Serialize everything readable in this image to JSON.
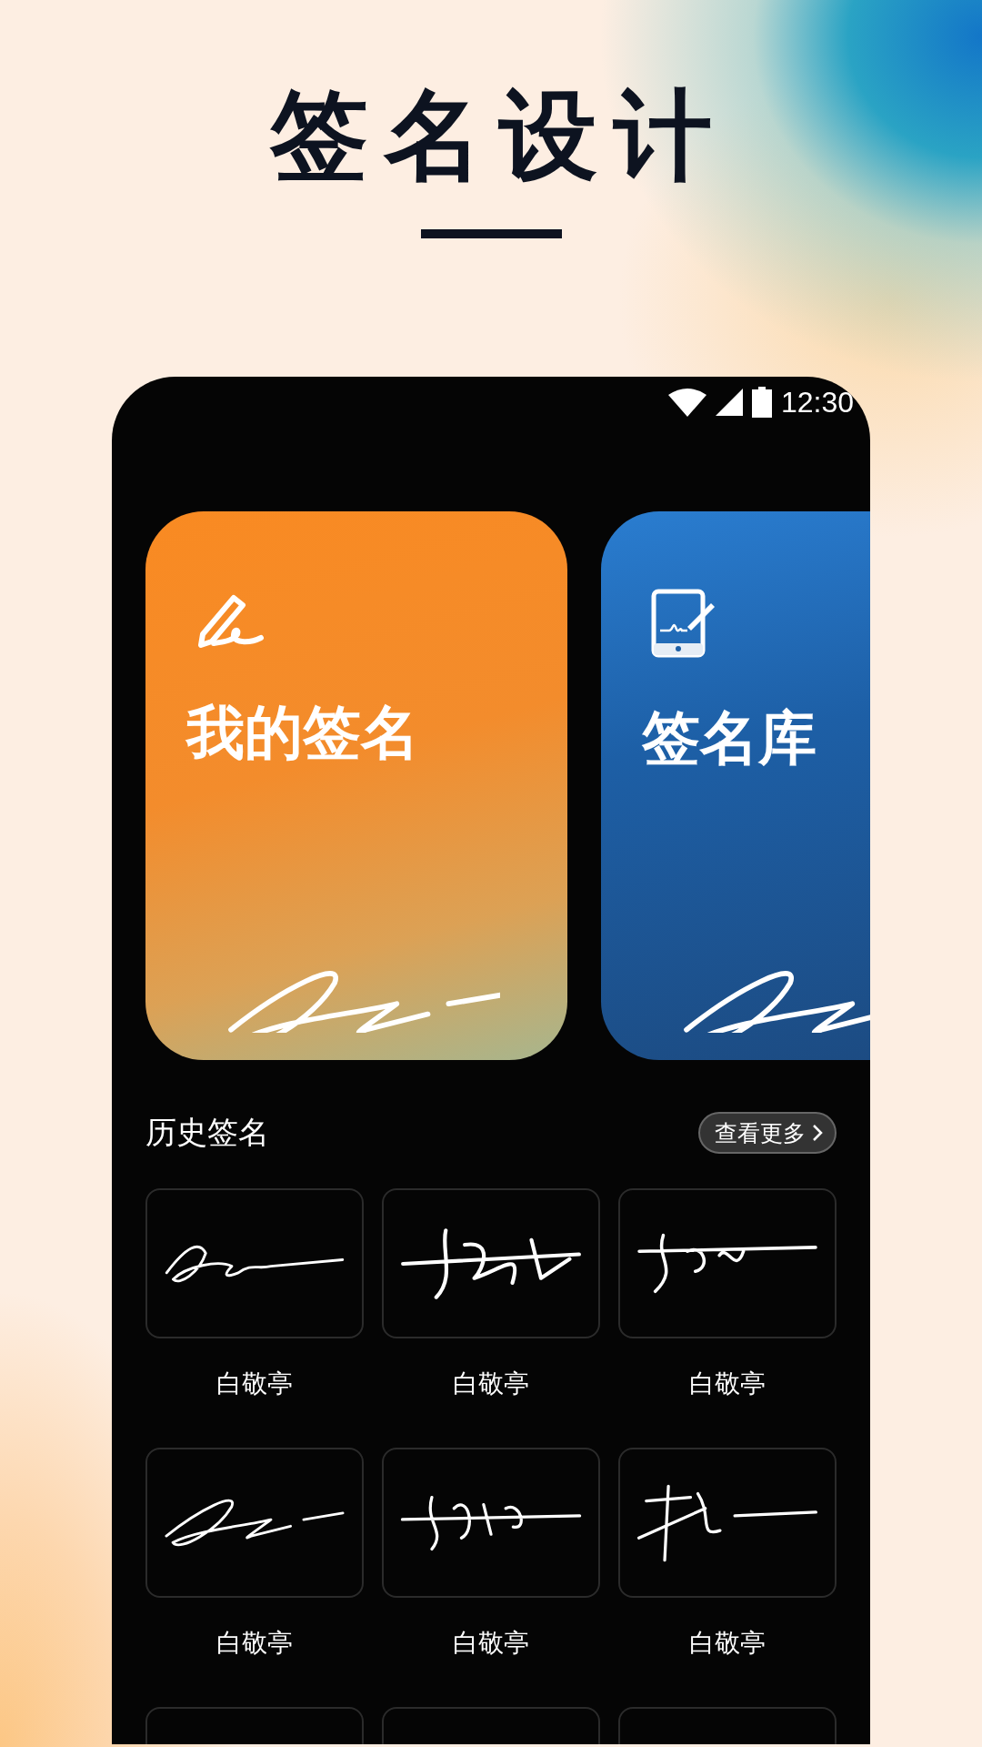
{
  "headline": "签名设计",
  "status_bar": {
    "time": "12:30"
  },
  "feature_cards": [
    {
      "kind": "pen",
      "title": "我的签名"
    },
    {
      "kind": "tablet",
      "title": "签名库"
    }
  ],
  "history": {
    "title": "历史签名",
    "more_button": "查看更多",
    "items": [
      {
        "kind": "full",
        "name": "白敬亭"
      },
      {
        "kind": "full",
        "name": "白敬亭"
      },
      {
        "kind": "full",
        "name": "白敬亭"
      },
      {
        "kind": "full",
        "name": "白敬亭"
      },
      {
        "kind": "full",
        "name": "白敬亭"
      },
      {
        "kind": "full",
        "name": "白敬亭"
      },
      {
        "kind": "cut"
      },
      {
        "kind": "cut"
      },
      {
        "kind": "cut"
      }
    ]
  }
}
